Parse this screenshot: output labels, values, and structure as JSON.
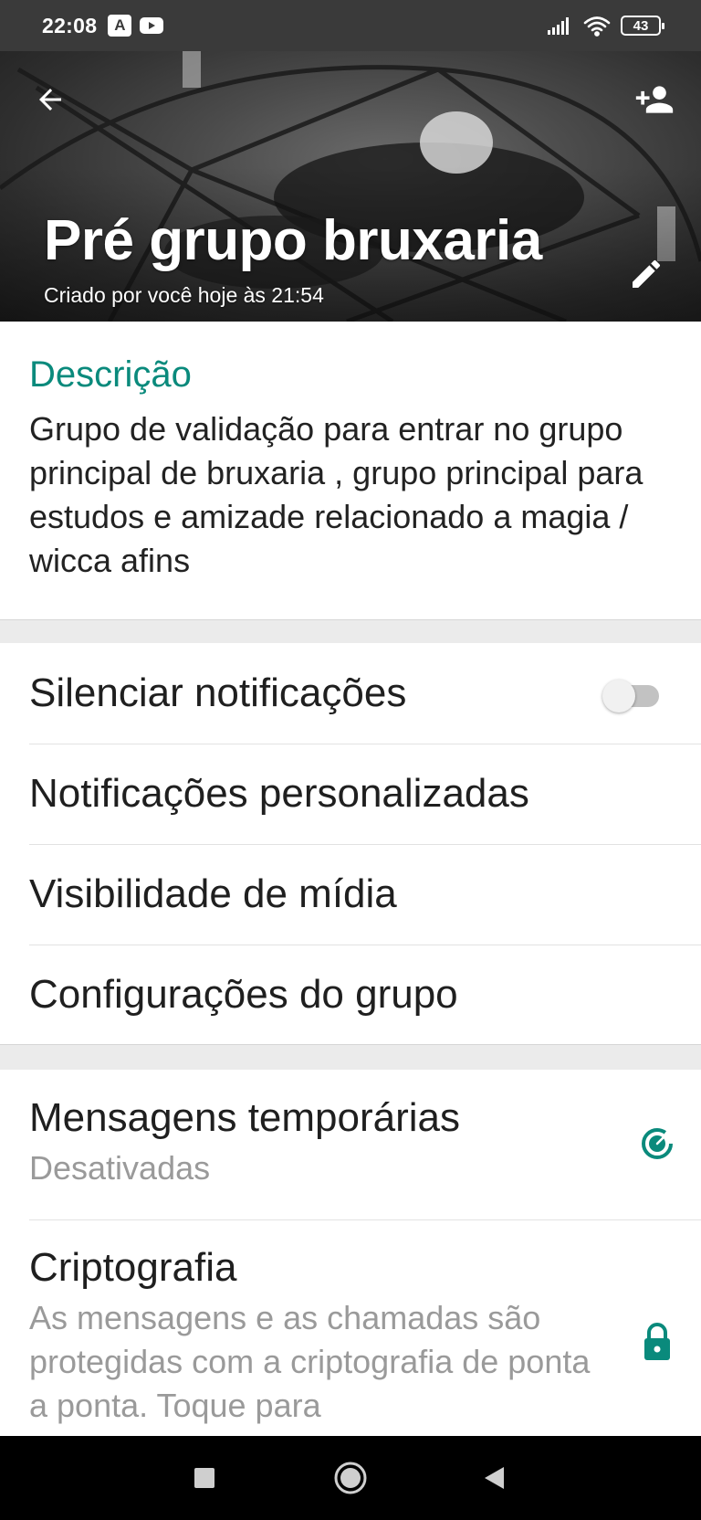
{
  "status_bar": {
    "time": "22:08",
    "app_icon_letter": "A",
    "battery": "43"
  },
  "header": {
    "title": "Pré grupo bruxaria",
    "subtitle": "Criado por você hoje às 21:54",
    "icons": {
      "back": "arrow-left-icon",
      "add_participant": "person-add-icon",
      "edit": "pencil-icon"
    }
  },
  "description": {
    "heading": "Descrição",
    "text": "Grupo de validação para entrar no grupo principal de bruxaria , grupo principal para estudos e amizade relacionado a magia / wicca afins"
  },
  "settings": {
    "mute_label": "Silenciar notificações",
    "mute_enabled": false,
    "custom_notifications_label": "Notificações personalizadas",
    "media_visibility_label": "Visibilidade de mídia",
    "group_settings_label": "Configurações do grupo"
  },
  "disappearing_messages": {
    "title": "Mensagens temporárias",
    "status": "Desativadas"
  },
  "encryption": {
    "title": "Criptografia",
    "text": "As mensagens e as chamadas são protegidas com a criptografia de ponta a ponta. Toque para"
  },
  "colors": {
    "accent": "#0a8a7c",
    "status_bar": "#3a3a3a",
    "nav_bar": "#000000",
    "secondary_text": "#9a9a9a"
  }
}
